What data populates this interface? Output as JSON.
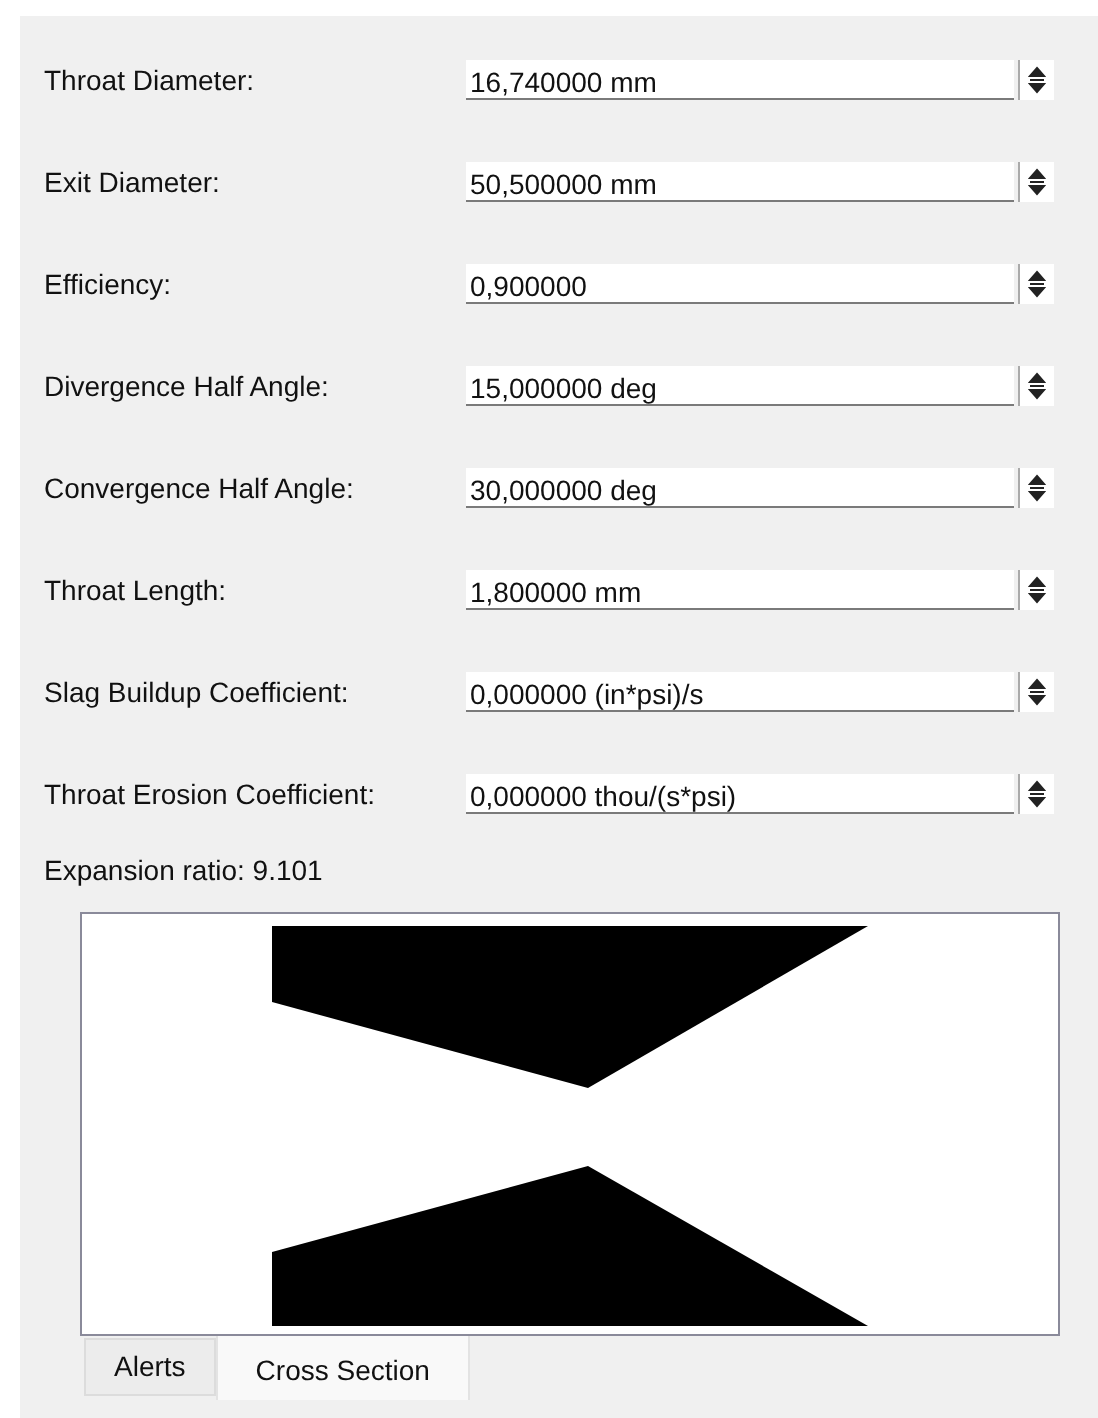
{
  "fields": [
    {
      "label": "Throat Diameter:",
      "value": "16,740000 mm"
    },
    {
      "label": "Exit Diameter:",
      "value": "50,500000 mm"
    },
    {
      "label": "Efficiency:",
      "value": "0,900000"
    },
    {
      "label": "Divergence Half Angle:",
      "value": "15,000000 deg"
    },
    {
      "label": "Convergence Half Angle:",
      "value": "30,000000 deg"
    },
    {
      "label": "Throat Length:",
      "value": "1,800000 mm"
    },
    {
      "label": "Slag Buildup Coefficient:",
      "value": "0,000000 (in*psi)/s"
    },
    {
      "label": "Throat Erosion Coefficient:",
      "value": "0,000000 thou/(s*psi)"
    }
  ],
  "expansion_ratio": "Expansion ratio: 9.101",
  "tabs": [
    {
      "label": "Alerts",
      "selected": false
    },
    {
      "label": "Cross Section",
      "selected": true
    }
  ]
}
